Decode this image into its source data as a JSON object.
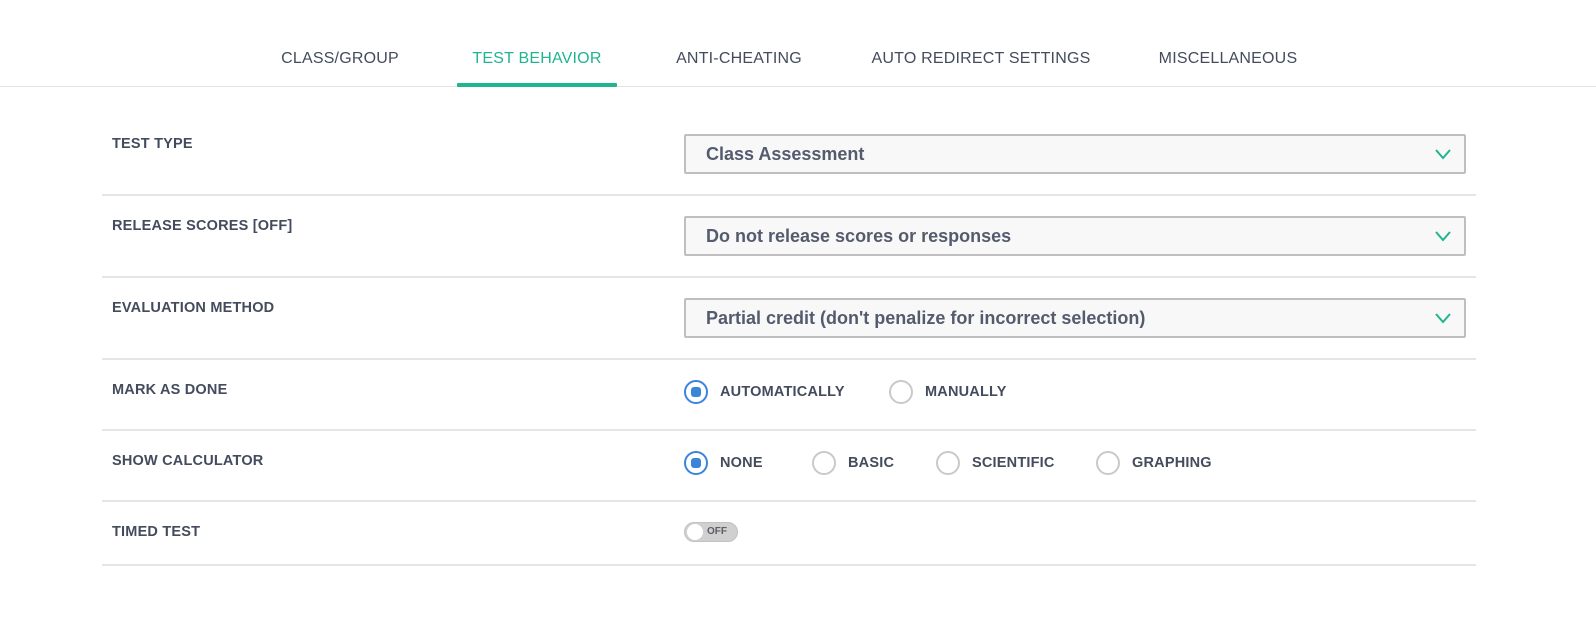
{
  "tabs": [
    {
      "label": "CLASS/GROUP",
      "active": false
    },
    {
      "label": "TEST BEHAVIOR",
      "active": true
    },
    {
      "label": "ANTI-CHEATING",
      "active": false
    },
    {
      "label": "AUTO REDIRECT SETTINGS",
      "active": false
    },
    {
      "label": "MISCELLANEOUS",
      "active": false
    }
  ],
  "settings": {
    "test_type": {
      "label": "TEST TYPE",
      "value": "Class Assessment",
      "icon": "chevron-down-icon"
    },
    "release_scores": {
      "label": "RELEASE SCORES [OFF]",
      "value": "Do not release scores or responses",
      "icon": "chevron-down-icon"
    },
    "evaluation_method": {
      "label": "EVALUATION METHOD",
      "value": "Partial credit (don't penalize for incorrect selection)",
      "icon": "chevron-down-icon"
    },
    "mark_as_done": {
      "label": "MARK AS DONE",
      "options": [
        {
          "label": "AUTOMATICALLY",
          "checked": true
        },
        {
          "label": "MANUALLY",
          "checked": false
        }
      ]
    },
    "show_calculator": {
      "label": "SHOW CALCULATOR",
      "options": [
        {
          "label": "NONE",
          "checked": true
        },
        {
          "label": "BASIC",
          "checked": false
        },
        {
          "label": "SCIENTIFIC",
          "checked": false
        },
        {
          "label": "GRAPHING",
          "checked": false
        }
      ]
    },
    "timed_test": {
      "label": "TIMED TEST",
      "toggle_text": "OFF",
      "on": false
    }
  },
  "colors": {
    "accent": "#1fb58f",
    "radio_checked": "#3a85d8",
    "text": "#434b5d"
  }
}
